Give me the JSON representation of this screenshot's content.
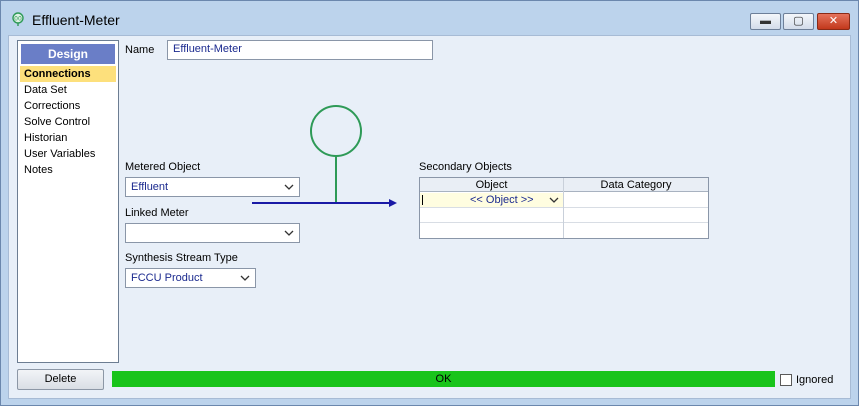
{
  "window": {
    "title": "Effluent-Meter",
    "minimize_glyph": "▬",
    "maximize_glyph": "▢",
    "close_glyph": "✕",
    "icon": "meter-app-icon"
  },
  "nav": {
    "header": "Design",
    "items": [
      "Connections",
      "Data Set",
      "Corrections",
      "Solve Control",
      "Historian",
      "User Variables",
      "Notes"
    ],
    "selected": "Connections",
    "colors": {
      "header_bg": "#6a7ec7",
      "selected_bg": "#fde07c"
    }
  },
  "form": {
    "name_label": "Name",
    "name_value": "Effluent-Meter",
    "metered_object_label": "Metered Object",
    "metered_object_value": "Effluent",
    "linked_meter_label": "Linked Meter",
    "linked_meter_value": "",
    "synthesis_stream_type_label": "Synthesis Stream Type",
    "synthesis_stream_type_value": "FCCU Product"
  },
  "secondary": {
    "label": "Secondary Objects",
    "columns": [
      "Object",
      "Data Category"
    ],
    "rows": [
      {
        "object": "<< Object >>",
        "data_category": ""
      },
      {
        "object": "",
        "data_category": ""
      },
      {
        "object": "",
        "data_category": ""
      }
    ]
  },
  "footer": {
    "delete_label": "Delete",
    "status_text": "OK",
    "status_color": "#19c41b",
    "ignored_label": "Ignored",
    "ignored_checked": false
  },
  "diagram": {
    "meter_symbol_color": "#2e9a57",
    "stream_color": "#1a1aa6"
  }
}
